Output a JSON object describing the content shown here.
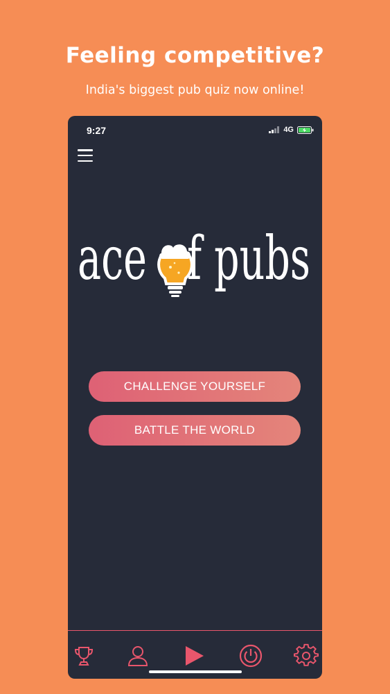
{
  "promo": {
    "headline": "Feeling competitive?",
    "subline": "India's biggest pub quiz now online!"
  },
  "status_bar": {
    "time": "9:27",
    "network": "4G"
  },
  "logo": {
    "text_left": "ace",
    "text_right": "f pubs"
  },
  "buttons": {
    "challenge_label": "CHALLENGE YOURSELF",
    "battle_label": "BATTLE THE WORLD"
  },
  "tabs": [
    {
      "icon": "trophy-icon"
    },
    {
      "icon": "user-icon"
    },
    {
      "icon": "play-icon"
    },
    {
      "icon": "power-icon"
    },
    {
      "icon": "gear-icon"
    }
  ],
  "colors": {
    "background": "#f68d55",
    "phone_bg": "#262b39",
    "accent": "#e9566c",
    "button_start": "#de6175",
    "button_end": "#e4857a",
    "beer": "#f6a623"
  }
}
